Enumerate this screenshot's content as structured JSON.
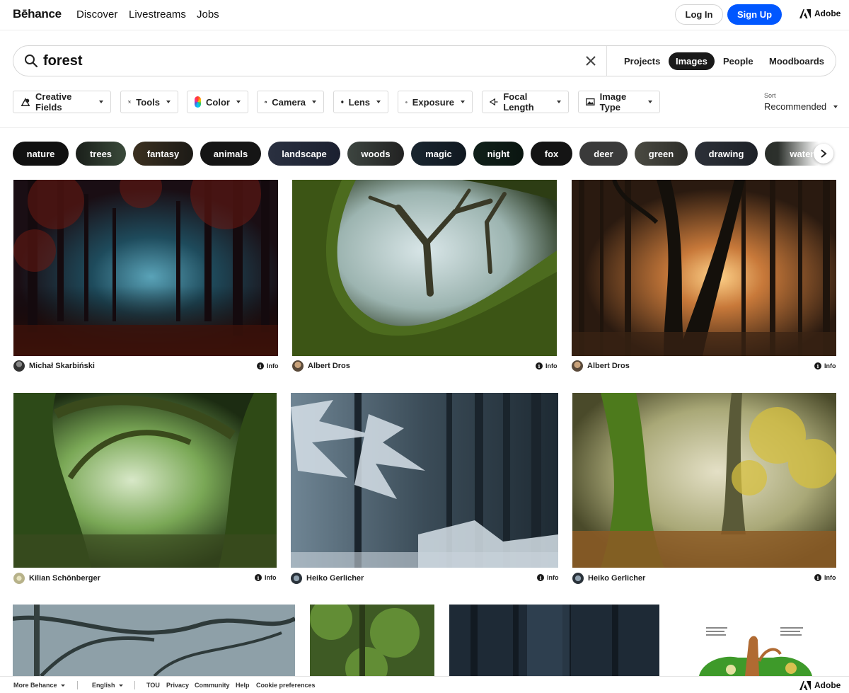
{
  "nav": {
    "logo": "Bēhance",
    "links": [
      "Discover",
      "Livestreams",
      "Jobs"
    ],
    "login": "Log In",
    "signup": "Sign Up",
    "adobe": "Adobe"
  },
  "search": {
    "query": "forest",
    "tabs": [
      "Projects",
      "Images",
      "People",
      "Moodboards"
    ],
    "active_tab": "Images"
  },
  "filters": [
    "Creative Fields",
    "Tools",
    "Color",
    "Camera",
    "Lens",
    "Exposure",
    "Focal Length",
    "Image Type"
  ],
  "sort": {
    "label": "Sort",
    "value": "Recommended"
  },
  "tags": [
    "nature",
    "trees",
    "fantasy",
    "animals",
    "landscape",
    "woods",
    "magic",
    "night",
    "fox",
    "deer",
    "green",
    "drawing",
    "waterco"
  ],
  "images": [
    {
      "owner": "Michał Skarbiński",
      "info": "Info"
    },
    {
      "owner": "Albert Dros",
      "info": "Info"
    },
    {
      "owner": "Albert Dros",
      "info": "Info"
    },
    {
      "owner": "Kilian Schönberger",
      "info": "Info"
    },
    {
      "owner": "Heiko Gerlicher",
      "info": "Info"
    },
    {
      "owner": "Heiko Gerlicher",
      "info": "Info"
    }
  ],
  "footer": {
    "more": "More Behance",
    "language": "English",
    "links": [
      "TOU",
      "Privacy",
      "Community",
      "Help",
      "Cookie preferences"
    ],
    "adobe": "Adobe"
  },
  "colors": {
    "accent": "#0057ff",
    "text": "#191919",
    "tag_bg": "#191919"
  }
}
